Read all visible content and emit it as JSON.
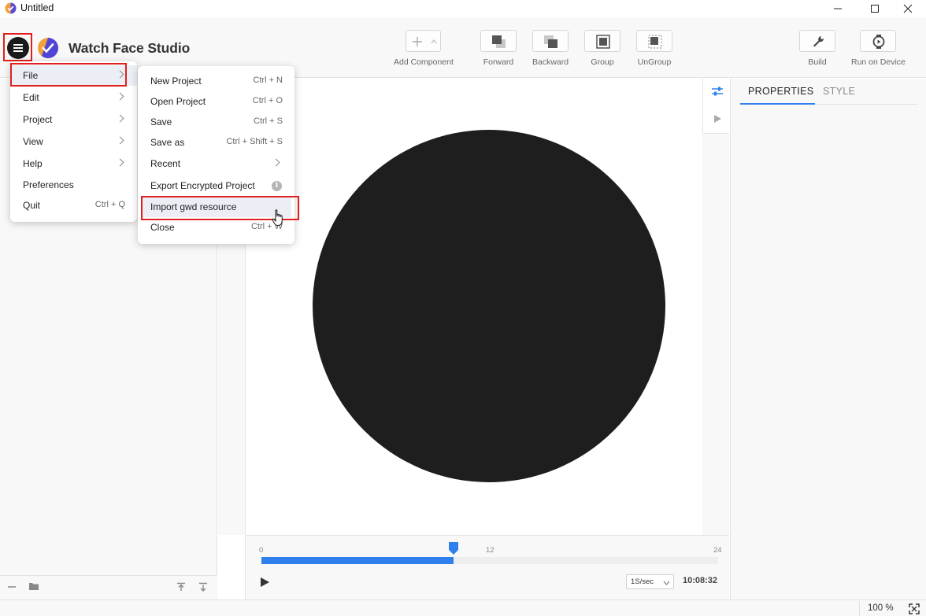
{
  "window": {
    "title": "Untitled"
  },
  "app": {
    "name": "Watch Face Studio"
  },
  "toolbar": {
    "add_component": "Add Component",
    "forward": "Forward",
    "backward": "Backward",
    "group": "Group",
    "ungroup": "UnGroup",
    "build": "Build",
    "run_on_device": "Run on Device"
  },
  "main_menu": {
    "items": [
      {
        "label": "File",
        "has_submenu": true
      },
      {
        "label": "Edit",
        "has_submenu": true
      },
      {
        "label": "Project",
        "has_submenu": true
      },
      {
        "label": "View",
        "has_submenu": true
      },
      {
        "label": "Help",
        "has_submenu": true
      },
      {
        "label": "Preferences",
        "has_submenu": false
      },
      {
        "label": "Quit",
        "shortcut": "Ctrl + Q"
      }
    ]
  },
  "file_menu": {
    "items": [
      {
        "label": "New Project",
        "shortcut": "Ctrl + N"
      },
      {
        "label": "Open Project",
        "shortcut": "Ctrl + O"
      },
      {
        "label": "Save",
        "shortcut": "Ctrl + S"
      },
      {
        "label": "Save as",
        "shortcut": "Ctrl + Shift + S"
      },
      {
        "label": "Recent",
        "has_submenu": true
      },
      {
        "label": "Export Encrypted Project",
        "info": "i"
      },
      {
        "label": "Import gwd resource"
      },
      {
        "label": "Close",
        "shortcut": "Ctrl + W"
      }
    ]
  },
  "right_panel": {
    "tabs": [
      "PROPERTIES",
      "STYLE"
    ],
    "active_tab": "PROPERTIES"
  },
  "timeline": {
    "ticks": [
      "0",
      "12",
      "24"
    ],
    "progress": 0.42,
    "speed": "1S/sec",
    "time": "10:08:32"
  },
  "status": {
    "zoom": "100 %"
  },
  "colors": {
    "accent": "#2f80ed",
    "highlight_box": "#e0201e",
    "watch_face": "#1e1e1e"
  },
  "icons": [
    "app-logo-icon",
    "hamburger-icon",
    "minimize-icon",
    "maximize-icon",
    "close-icon",
    "plus-icon",
    "chevron-up-icon",
    "forward-icon",
    "backward-icon",
    "group-icon",
    "ungroup-icon",
    "wrench-icon",
    "watch-icon",
    "sliders-icon",
    "play-icon",
    "minus-icon",
    "folder-icon",
    "move-up-icon",
    "move-down-icon",
    "fit-screen-icon",
    "pointer-hand-icon"
  ]
}
